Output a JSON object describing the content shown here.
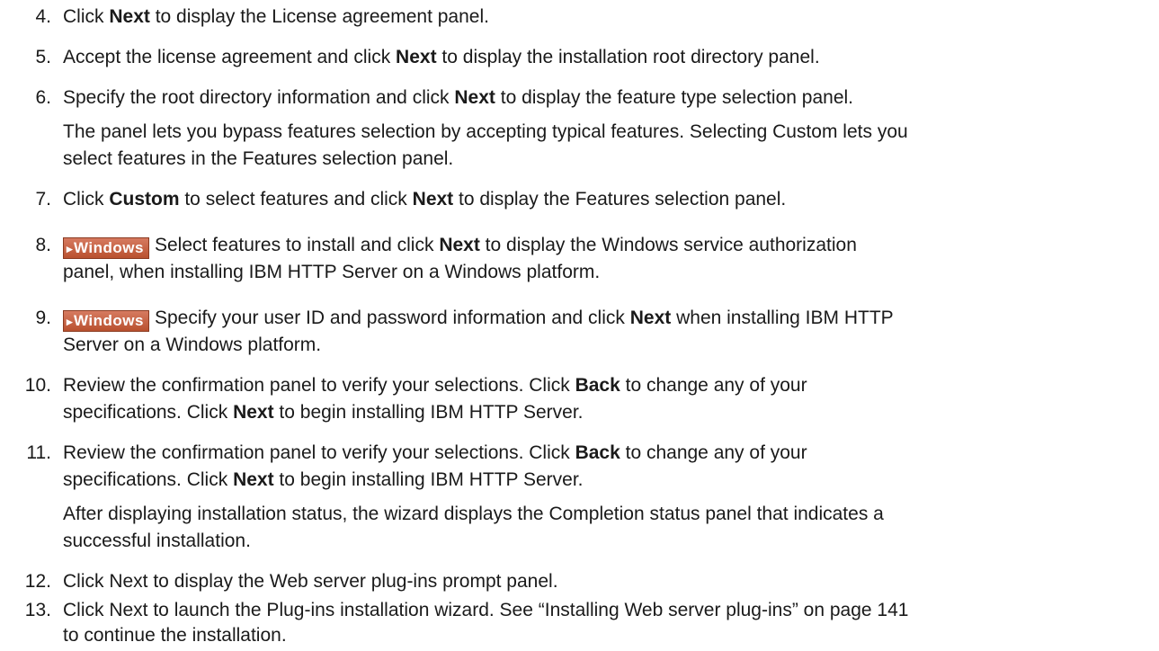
{
  "steps": [
    {
      "number": "4.",
      "parts": [
        {
          "text": "Click "
        },
        {
          "text": "Next",
          "bold": true
        },
        {
          "text": " to display the License agreement panel."
        }
      ]
    },
    {
      "number": "5.",
      "parts": [
        {
          "text": "Accept the license agreement and click "
        },
        {
          "text": "Next",
          "bold": true
        },
        {
          "text": " to display the installation root directory panel."
        }
      ]
    },
    {
      "number": "6.",
      "parts": [
        {
          "text": "Specify the root directory information and click "
        },
        {
          "text": "Next",
          "bold": true
        },
        {
          "text": " to display the feature type selection panel."
        }
      ]
    },
    {
      "number": "7.",
      "parts": [
        {
          "text": "Click "
        },
        {
          "text": "Custom",
          "bold": true
        },
        {
          "text": " to select features and click "
        },
        {
          "text": "Next",
          "bold": true
        },
        {
          "text": " to display the Features selection panel."
        }
      ]
    },
    {
      "number": "8.",
      "badge": "Windows",
      "parts": [
        {
          "text": "Select features to install and click "
        },
        {
          "text": "Next",
          "bold": true
        },
        {
          "text": " to display the Windows service authorization"
        }
      ]
    },
    {
      "number": "9.",
      "badge": "Windows",
      "parts": [
        {
          "text": "Specify your user ID and password information and click "
        },
        {
          "text": "Next",
          "bold": true
        },
        {
          "text": " when installing IBM HTTP"
        }
      ]
    },
    {
      "number": "10.",
      "parts": [
        {
          "text": "Review the confirmation panel to verify your selections. Click "
        },
        {
          "text": "Back",
          "bold": true
        },
        {
          "text": " to change any of your"
        }
      ]
    },
    {
      "number": "11.",
      "parts": [
        {
          "text": "Review the confirmation panel to verify your selections. Click "
        },
        {
          "text": "Back",
          "bold": true
        },
        {
          "text": " to change any of your"
        }
      ]
    },
    {
      "number": "12.",
      "parts": [
        {
          "text": "Click Next to display the Web server plug-ins prompt panel."
        }
      ]
    },
    {
      "number": "13.",
      "parts": [
        {
          "text": "Click Next to launch the Plug-ins installation wizard. See “Installing Web server plug-ins” on page 141"
        }
      ]
    }
  ],
  "continuations": {
    "step6_note_line1": "The panel lets you bypass features selection by accepting typical features. Selecting Custom lets you",
    "step6_note_line2": "select features in the Features selection panel.",
    "step8_line2": "panel, when installing IBM HTTP Server on a Windows platform.",
    "step9_line2": "Server on a Windows platform.",
    "step10_line2_pre": "specifications. Click ",
    "step10_line2_bold": "Next",
    "step10_line2_post": " to begin installing IBM HTTP Server.",
    "step11_line2_pre": "specifications. Click ",
    "step11_line2_bold": "Next",
    "step11_line2_post": " to begin installing IBM HTTP Server.",
    "step11_note_line1": "After displaying installation status, the wizard displays the Completion status panel that indicates a",
    "step11_note_line2": "successful installation.",
    "step13_line2": "to continue the installation."
  }
}
